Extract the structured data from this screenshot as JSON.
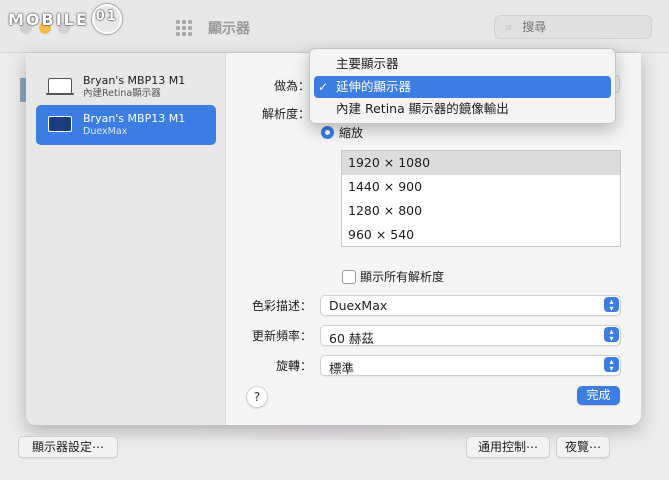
{
  "window": {
    "title": "顯示器",
    "search_placeholder": "搜尋"
  },
  "logo": {
    "text": "MOBILE",
    "seal_text": "01"
  },
  "sidebar": {
    "displays": [
      {
        "name": "Bryan's MBP13 M1",
        "subtitle": "內建Retina顯示器",
        "selected": false
      },
      {
        "name": "Bryan's MBP13 M1",
        "subtitle": "DuexMax",
        "selected": true
      }
    ]
  },
  "settings": {
    "use_as_label": "做為：",
    "resolution_label": "解析度：",
    "scaled_label": "縮放",
    "resolutions": [
      "1920 × 1080",
      "1440 × 900",
      "1280 × 800",
      "960 × 540"
    ],
    "selected_resolution": "1920 × 1080",
    "show_all_label": "顯示所有解析度",
    "color_profile_label": "色彩描述：",
    "color_profile_value": "DuexMax",
    "refresh_rate_label": "更新頻率：",
    "refresh_rate_value": "60 赫茲",
    "rotation_label": "旋轉：",
    "rotation_value": "標準",
    "help_label": "?",
    "done_label": "完成"
  },
  "use_as_menu": {
    "items": [
      {
        "label": "主要顯示器",
        "checked": false
      },
      {
        "label": "延伸的顯示器",
        "checked": true
      },
      {
        "label": "內建 Retina 顯示器的鏡像輸出",
        "checked": false
      }
    ],
    "check_glyph": "✓"
  },
  "bottom_bar": {
    "display_settings": "顯示器設定⋯",
    "universal_control": "通用控制⋯",
    "night_shift": "夜覽⋯"
  },
  "colors": {
    "accent": "#3b7de2"
  }
}
